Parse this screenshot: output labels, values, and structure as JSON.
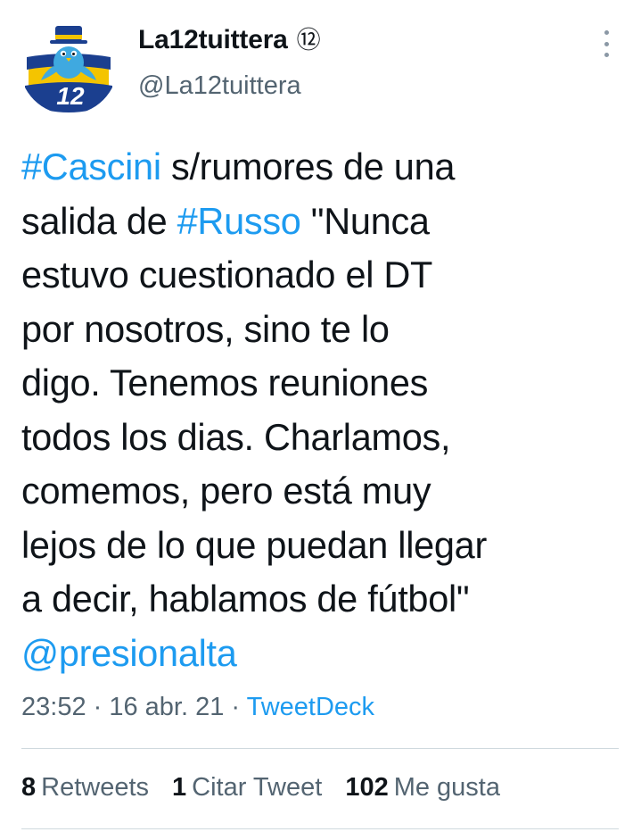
{
  "author": {
    "display_name": "La12tuittera",
    "badge": "⑫",
    "handle": "@La12tuittera",
    "avatar_number": "12"
  },
  "tweet": {
    "lines": [
      [
        {
          "text": "#Cascini",
          "tag": true
        },
        {
          "text": " s/rumores de una",
          "tag": false
        }
      ],
      [
        {
          "text": "salida de ",
          "tag": false
        },
        {
          "text": "#Russo",
          "tag": true
        },
        {
          "text": " \"Nunca",
          "tag": false
        }
      ],
      [
        {
          "text": "estuvo cuestionado el DT",
          "tag": false
        }
      ],
      [
        {
          "text": "por nosotros, sino te lo",
          "tag": false
        }
      ],
      [
        {
          "text": "digo. Tenemos reuniones",
          "tag": false
        }
      ],
      [
        {
          "text": "todos los dias. Charlamos,",
          "tag": false
        }
      ],
      [
        {
          "text": "comemos, pero está muy",
          "tag": false
        }
      ],
      [
        {
          "text": "lejos de lo que puedan llegar",
          "tag": false
        }
      ],
      [
        {
          "text": "a decir, hablamos de fútbol\"",
          "tag": false
        }
      ],
      [
        {
          "text": "@presionalta",
          "tag": true
        }
      ]
    ]
  },
  "meta": {
    "time": "23:52",
    "separator": " · ",
    "date": "16 abr. 21",
    "source": "TweetDeck"
  },
  "stats": [
    {
      "count": "8",
      "label": "Retweets"
    },
    {
      "count": "1",
      "label": "Citar Tweet"
    },
    {
      "count": "102",
      "label": "Me gusta"
    }
  ],
  "colors": {
    "link": "#1d9bf0",
    "text": "#0f1419",
    "secondary": "#536471",
    "avatar_blue": "#1b3f8f",
    "avatar_yellow": "#f4c400",
    "bird_blue": "#3fa9e0"
  }
}
